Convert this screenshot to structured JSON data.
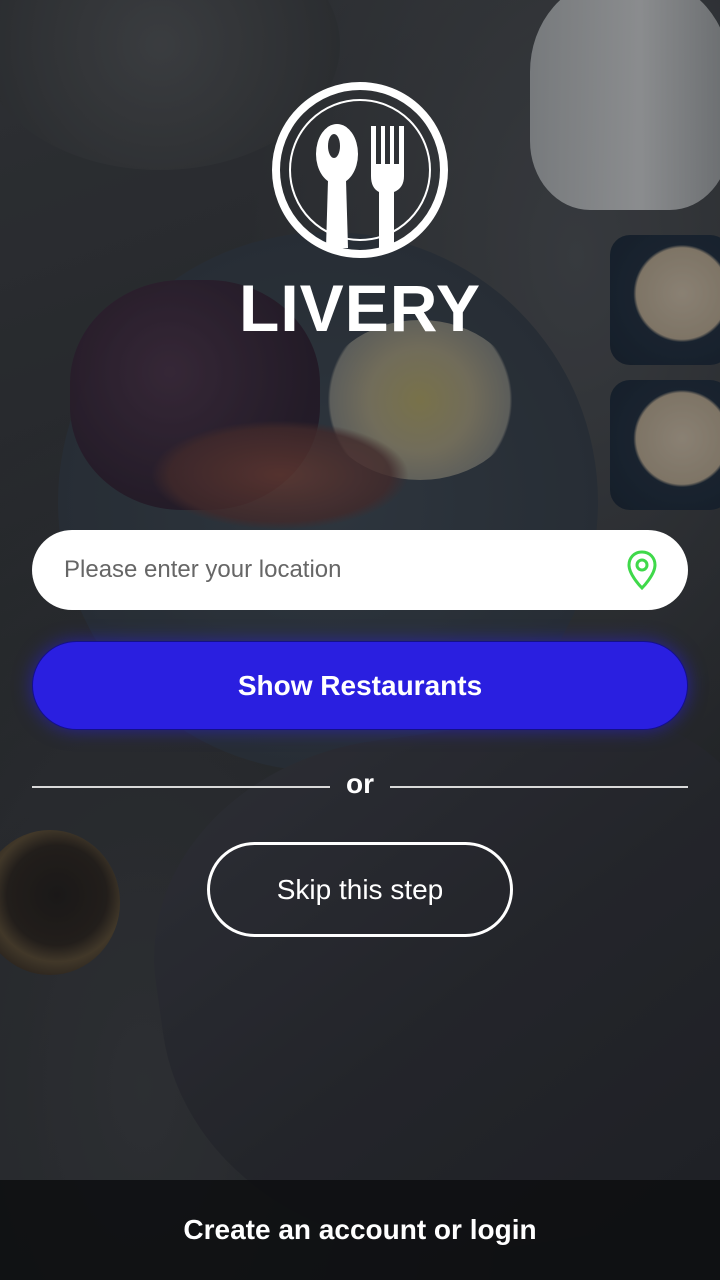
{
  "brand": {
    "name": "LIVERY",
    "logo_icon": "spoon-fork-icon"
  },
  "location": {
    "placeholder": "Please enter your location",
    "value": "",
    "icon": "location-pin-icon",
    "icon_color": "#3fd94a"
  },
  "actions": {
    "show_restaurants_label": "Show Restaurants",
    "or_label": "or",
    "skip_label": "Skip this step"
  },
  "footer": {
    "auth_label": "Create an account or login"
  },
  "colors": {
    "primary_button": "#2a1fe0",
    "text": "#ffffff"
  }
}
